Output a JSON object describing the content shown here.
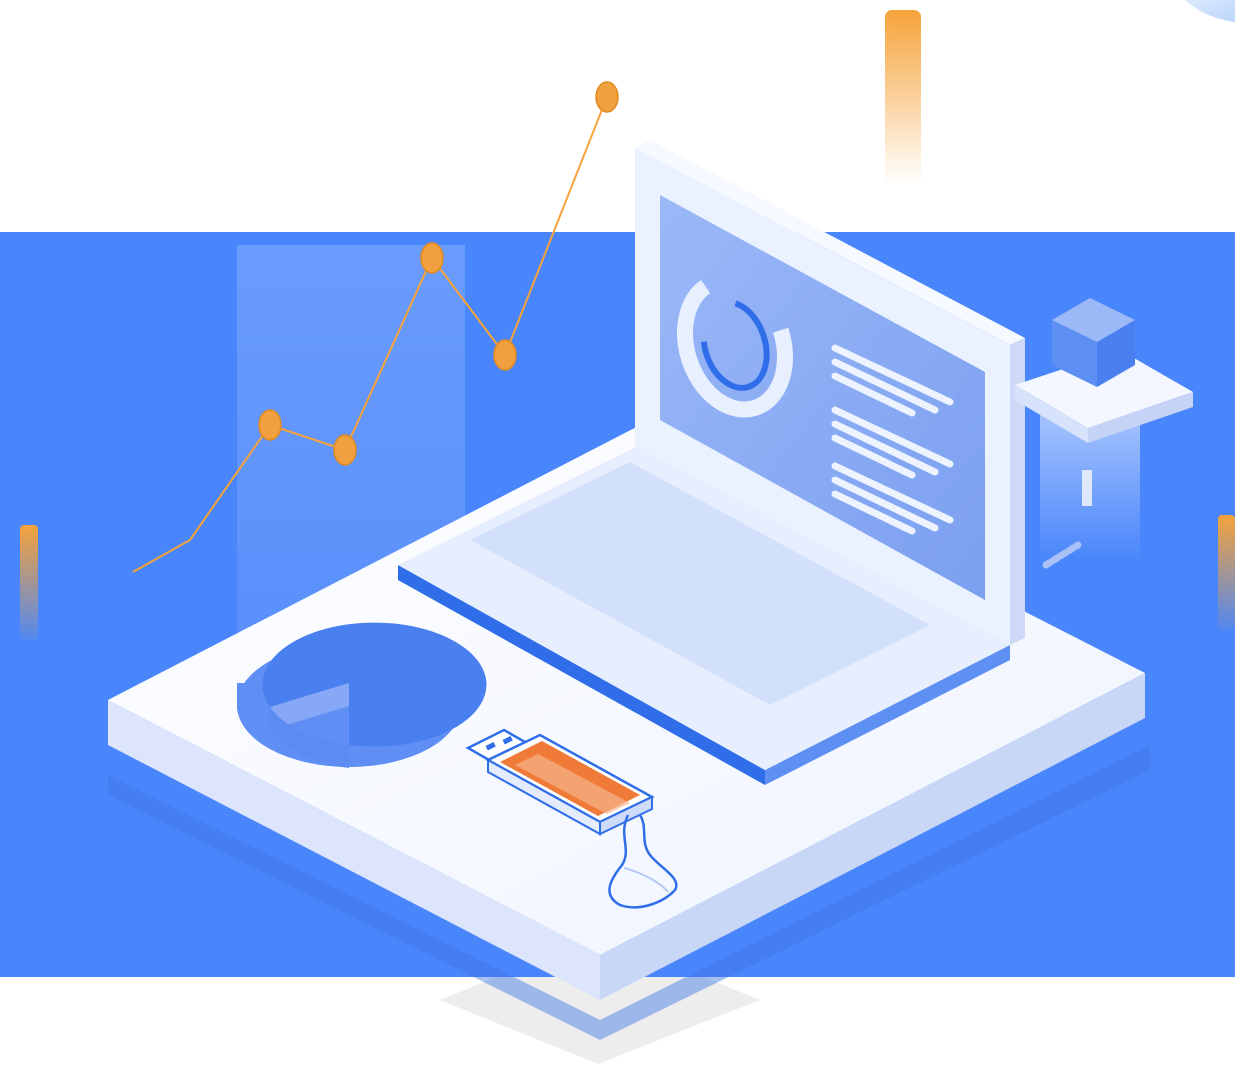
{
  "illustration": {
    "subject": "isometric-laptop-data-analytics",
    "icons": [
      "line-chart-icon",
      "pie-chart-icon",
      "donut-chart-icon",
      "laptop-icon",
      "keyboard-icon",
      "usb-drive-icon",
      "cube-icon",
      "text-lines-icon"
    ],
    "colors": {
      "background_band": "#4a86fb",
      "platform_top": "#f4f7ff",
      "platform_side": "#d7e2fb",
      "laptop_light": "#e6eeff",
      "screen": "#8aaaf5",
      "accent_blue": "#2f6ee8",
      "accent_orange": "#f5a33a",
      "usb_orange": "#f07a38",
      "floor_shadow": "#ececec"
    }
  }
}
